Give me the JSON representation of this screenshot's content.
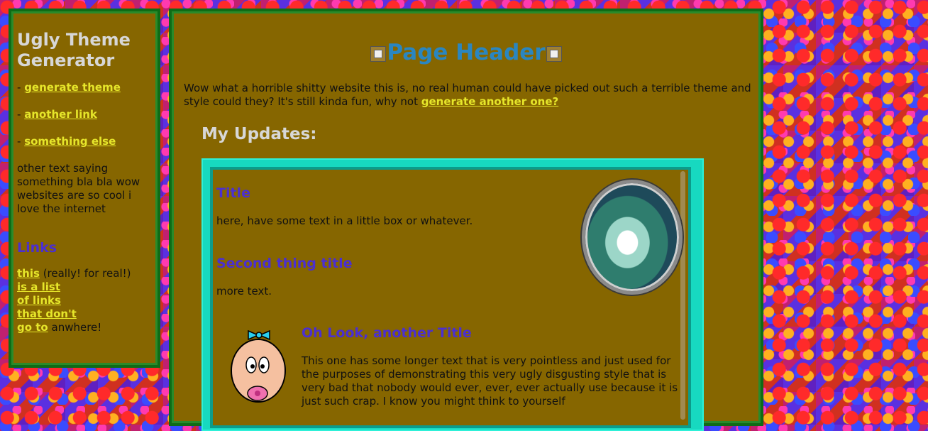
{
  "sidebar": {
    "title": "Ugly Theme Generator",
    "nav": [
      {
        "prefix": "- ",
        "label": "generate theme"
      },
      {
        "prefix": "- ",
        "label": "another link"
      },
      {
        "prefix": "- ",
        "label": "something else"
      }
    ],
    "text": "other text saying something bla bla wow websites are so cool i love the internet",
    "links_title": "Links",
    "links": {
      "link1": "this",
      "after1": " (really! for real!)",
      "link2": "is a list",
      "link3": "of links",
      "link4": "that don't",
      "link5": "go to",
      "after5": " anwhere!"
    }
  },
  "main": {
    "header": "Page Header",
    "intro_text": "Wow what a horrible shitty website this is, no real human could have picked out such a terrible theme and style could they? It's still kinda fun, why not ",
    "intro_link": "generate another one?",
    "updates_title": "My Updates:",
    "box": {
      "title1": "Title",
      "text1": "here, have some text in a little box or whatever.",
      "title2": "Second thing title",
      "text2": "more text.",
      "title3": "Oh Look, another Title",
      "text3": "This one has some longer text that is very pointless and just used for the purposes of demonstrating this very ugly disgusting style that is very bad that nobody would ever, ever, ever actually use because it is just such crap. I know you might think to yourself"
    }
  },
  "colors": {
    "panel": "#866600",
    "link": "#e6e62a",
    "heading_purple": "#4b2fd0",
    "header_blue": "#2a86c0",
    "teal": "#17d9c0",
    "green_border": "#0f6b16"
  }
}
